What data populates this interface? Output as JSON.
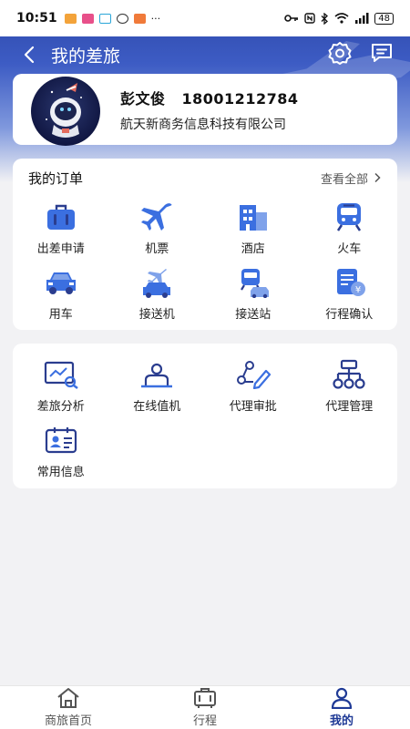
{
  "status_bar": {
    "time": "10:51",
    "battery": "48",
    "ellipsis": "···"
  },
  "navbar": {
    "title": "我的差旅"
  },
  "profile": {
    "name": "彭文俊",
    "phone": "18001212784",
    "company": "航天新商务信息科技有限公司"
  },
  "orders": {
    "title": "我的订单",
    "view_all": "查看全部",
    "items": [
      {
        "label": "出差申请",
        "icon": "suitcase-icon"
      },
      {
        "label": "机票",
        "icon": "airplane-icon"
      },
      {
        "label": "酒店",
        "icon": "hotel-icon"
      },
      {
        "label": "火车",
        "icon": "train-icon"
      },
      {
        "label": "用车",
        "icon": "car-icon"
      },
      {
        "label": "接送机",
        "icon": "airport-transfer-icon"
      },
      {
        "label": "接送站",
        "icon": "station-transfer-icon"
      },
      {
        "label": "行程确认",
        "icon": "itinerary-confirm-icon"
      }
    ]
  },
  "tools": {
    "items": [
      {
        "label": "差旅分析",
        "icon": "analytics-icon"
      },
      {
        "label": "在线值机",
        "icon": "checkin-icon"
      },
      {
        "label": "代理审批",
        "icon": "proxy-approval-icon"
      },
      {
        "label": "代理管理",
        "icon": "proxy-management-icon"
      },
      {
        "label": "常用信息",
        "icon": "contact-card-icon"
      }
    ]
  },
  "tabbar": {
    "items": [
      {
        "label": "商旅首页",
        "icon": "home-icon",
        "active": false
      },
      {
        "label": "行程",
        "icon": "trip-icon",
        "active": false
      },
      {
        "label": "我的",
        "icon": "user-icon",
        "active": true
      }
    ]
  },
  "colors": {
    "brand": "#3d5cc4",
    "icon_blue": "#3b6fe0",
    "icon_dark": "#2a3d8f",
    "active_tab": "#1f3a96"
  }
}
